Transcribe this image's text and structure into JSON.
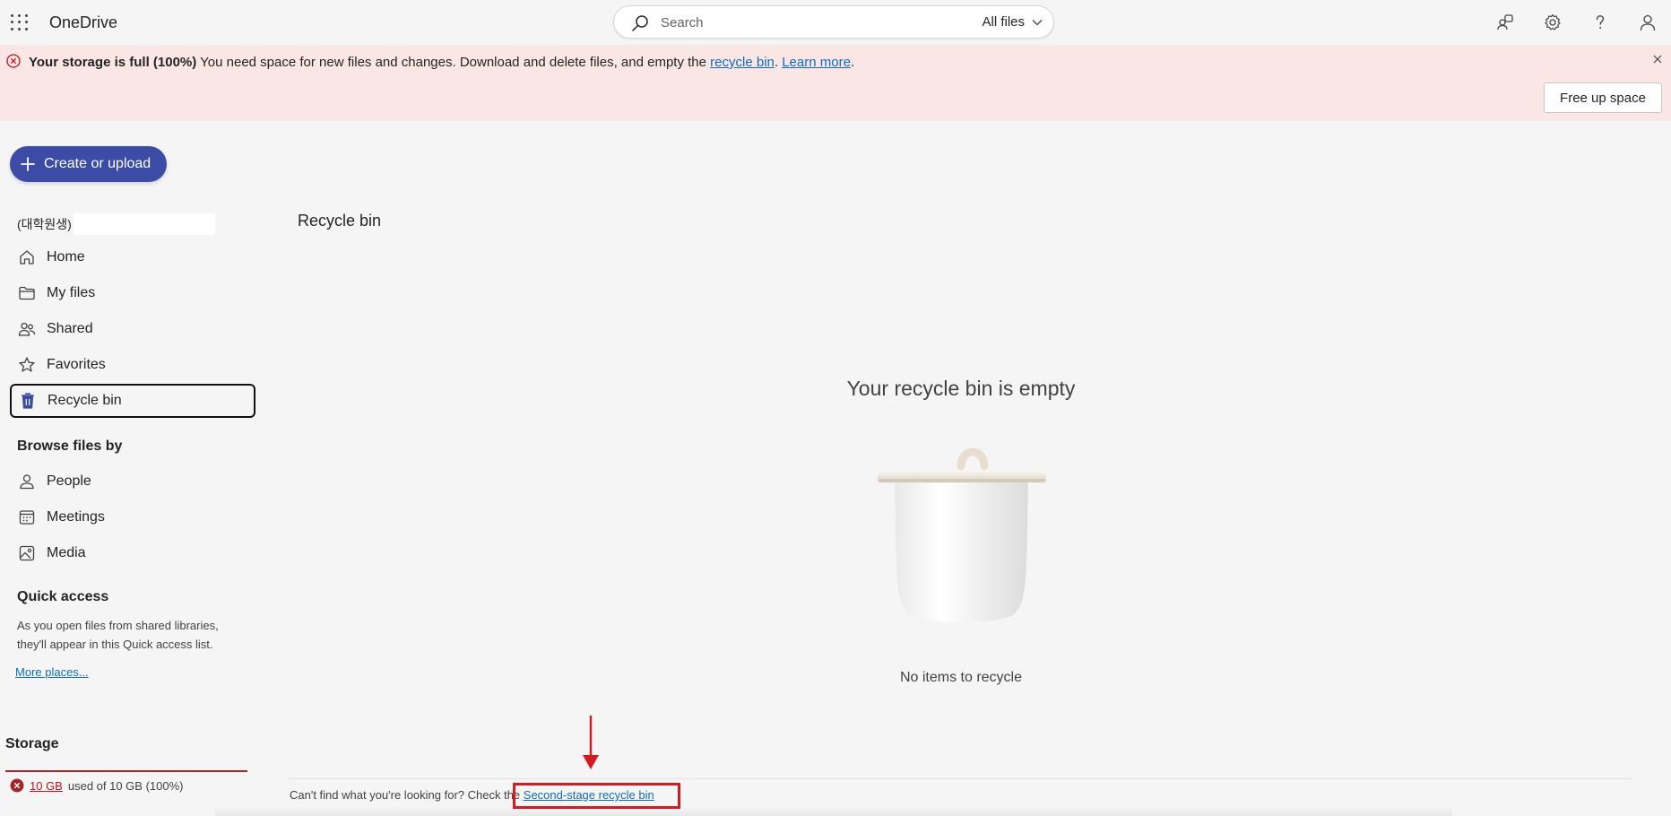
{
  "header": {
    "app_name": "OneDrive",
    "search_placeholder": "Search",
    "search_scope": "All files"
  },
  "banner": {
    "title": "Your storage is full (100%)",
    "message": " You need space for new files and changes. Download and delete files, and empty the ",
    "recycle_link": "recycle bin",
    "separator": ". ",
    "learn_more": "Learn more",
    "end": ".",
    "action_button": "Free up space"
  },
  "sidebar": {
    "create_label": "Create or upload",
    "account": "(대학원생)",
    "nav": [
      {
        "label": "Home",
        "icon": "home-icon"
      },
      {
        "label": "My files",
        "icon": "folder-icon"
      },
      {
        "label": "Shared",
        "icon": "people-icon"
      },
      {
        "label": "Favorites",
        "icon": "star-icon"
      },
      {
        "label": "Recycle bin",
        "icon": "recycle-bin-icon",
        "selected": true
      }
    ],
    "browse_title": "Browse files by",
    "browse": [
      {
        "label": "People",
        "icon": "person-icon"
      },
      {
        "label": "Meetings",
        "icon": "calendar-icon"
      },
      {
        "label": "Media",
        "icon": "image-icon"
      }
    ],
    "quick_access_title": "Quick access",
    "quick_access_text": "As you open files from shared libraries, they'll appear in this Quick access list.",
    "more_places": "More places...",
    "storage_title": "Storage",
    "storage_used": "10 GB",
    "storage_rest": "used of 10 GB (100%)",
    "storage_fraction": 1.0
  },
  "main": {
    "page_title": "Recycle bin",
    "empty_title": "Your recycle bin is empty",
    "empty_subtitle": "No items to recycle",
    "footer_prefix": "Can't find what you're looking for? Check the ",
    "footer_link": "Second-stage recycle bin"
  },
  "colors": {
    "accent": "#3c4ba6",
    "banner_bg": "#fbe6e6",
    "error": "#c50f1f",
    "link": "#0f6cbd",
    "annotation": "#d71920"
  }
}
